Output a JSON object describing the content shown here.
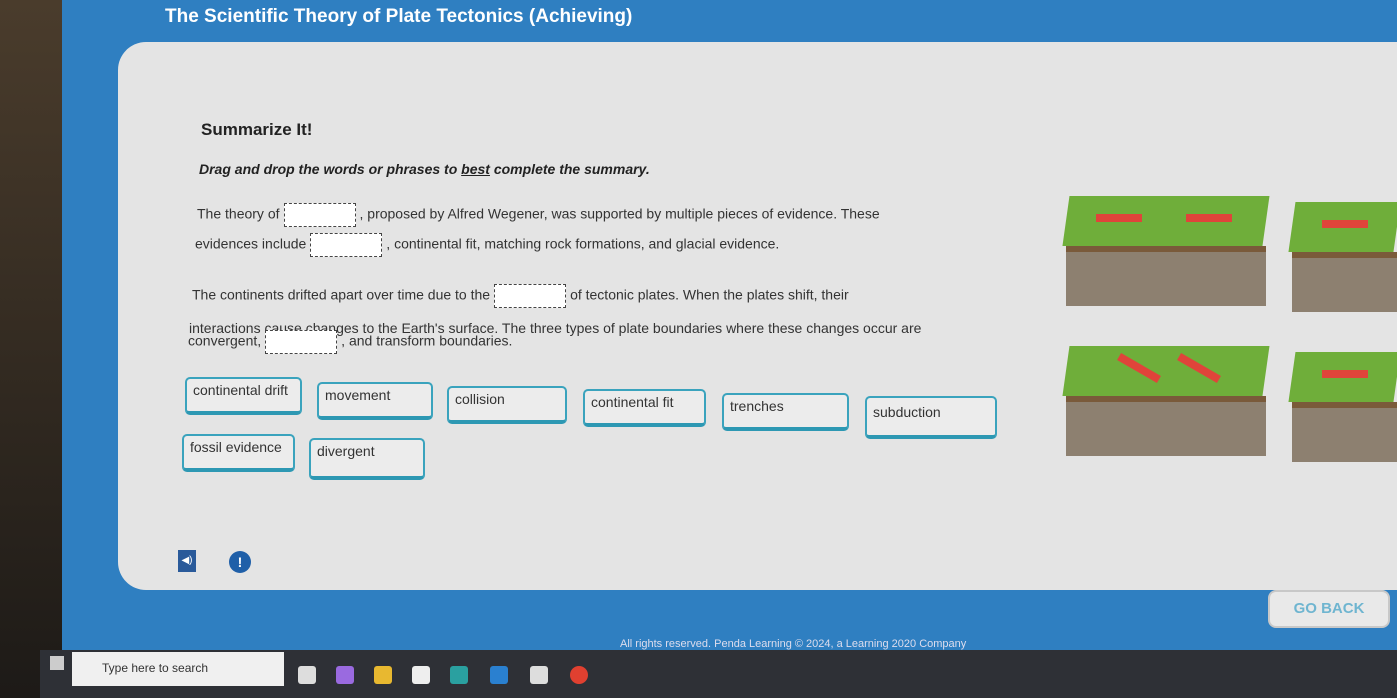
{
  "header": {
    "title": "The Scientific Theory of Plate Tectonics (Achieving)"
  },
  "activity": {
    "heading": "Summarize It!",
    "instruction_pre": "Drag and drop the words or phrases to ",
    "instruction_em": "best",
    "instruction_post": " complete the summary.",
    "lines": [
      [
        "The theory of",
        ", proposed by Alfred Wegener, was supported by multiple pieces of evidence. These"
      ],
      [
        "evidences include",
        ", continental fit, matching rock formations, and glacial evidence."
      ],
      [
        "The continents drifted apart over time due to the",
        "of tectonic plates. When the plates shift, their"
      ],
      [
        "interactions cause changes to the Earth's surface. The three types of plate boundaries where these changes occur are"
      ],
      [
        "convergent,",
        ", and transform boundaries."
      ]
    ],
    "tiles": [
      "continental drift",
      "movement",
      "collision",
      "continental fit",
      "trenches",
      "subduction",
      "fossil evidence",
      "divergent"
    ]
  },
  "buttons": {
    "go_back": "GO BACK"
  },
  "footer": "All rights reserved. Penda Learning © 2024, a Learning 2020 Company",
  "taskbar": {
    "search_placeholder": "Type here to search"
  },
  "colors": {
    "screen_bg": "#2f7fc1",
    "tile_border": "#3aa3bd",
    "arrow": "#e0443a"
  }
}
